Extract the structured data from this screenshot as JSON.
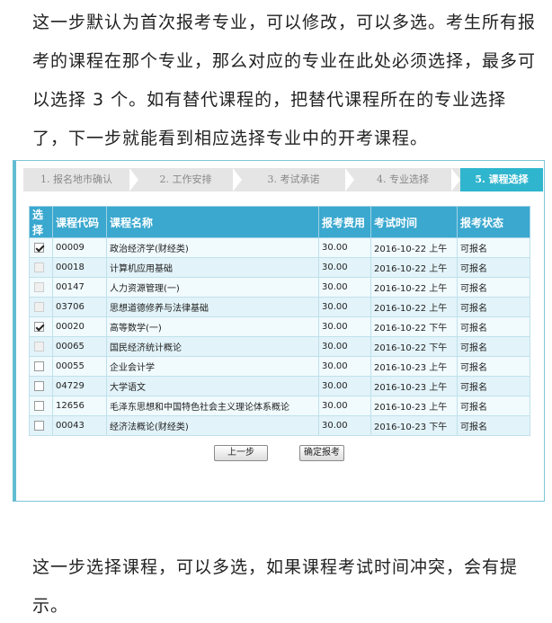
{
  "intro_text": "这一步默认为首次报考专业，可以修改，可以多选。考生所有报考的课程在那个专业，那么对应的专业在此处必须选择，最多可以选择 3 个。如有替代课程的，把替代课程所在的专业选择了，下一步就能看到相应选择专业中的开考课程。",
  "outro_text": "这一步选择课程，可以多选，如果课程考试时间冲突，会有提示。",
  "steps": [
    {
      "label": "1. 报名地市确认"
    },
    {
      "label": "2. 工作安排"
    },
    {
      "label": "3. 考试承诺"
    },
    {
      "label": "4. 专业选择"
    },
    {
      "label": "5. 课程选择"
    }
  ],
  "table": {
    "headers": [
      "选择",
      "课程代码",
      "课程名称",
      "报考费用",
      "考试时间",
      "报考状态"
    ],
    "rows": [
      {
        "checked": "true",
        "disabled": "false",
        "code": "00009",
        "name": "政治经济学(财经类)",
        "fee": "30.00",
        "time": "2016-10-22 上午",
        "status": "可报名"
      },
      {
        "checked": "false",
        "disabled": "true",
        "code": "00018",
        "name": "计算机应用基础",
        "fee": "30.00",
        "time": "2016-10-22 上午",
        "status": "可报名"
      },
      {
        "checked": "false",
        "disabled": "true",
        "code": "00147",
        "name": "人力资源管理(一)",
        "fee": "30.00",
        "time": "2016-10-22 上午",
        "status": "可报名"
      },
      {
        "checked": "false",
        "disabled": "true",
        "code": "03706",
        "name": "思想道德修养与法律基础",
        "fee": "30.00",
        "time": "2016-10-22 上午",
        "status": "可报名"
      },
      {
        "checked": "true",
        "disabled": "false",
        "code": "00020",
        "name": "高等数学(一)",
        "fee": "30.00",
        "time": "2016-10-22 下午",
        "status": "可报名"
      },
      {
        "checked": "false",
        "disabled": "true",
        "code": "00065",
        "name": "国民经济统计概论",
        "fee": "30.00",
        "time": "2016-10-22 下午",
        "status": "可报名"
      },
      {
        "checked": "false",
        "disabled": "false",
        "code": "00055",
        "name": "企业会计学",
        "fee": "30.00",
        "time": "2016-10-23 上午",
        "status": "可报名"
      },
      {
        "checked": "false",
        "disabled": "false",
        "code": "04729",
        "name": "大学语文",
        "fee": "30.00",
        "time": "2016-10-23 上午",
        "status": "可报名"
      },
      {
        "checked": "false",
        "disabled": "false",
        "code": "12656",
        "name": "毛泽东思想和中国特色社会主义理论体系概论",
        "fee": "30.00",
        "time": "2016-10-23 上午",
        "status": "可报名"
      },
      {
        "checked": "false",
        "disabled": "false",
        "code": "00043",
        "name": "经济法概论(财经类)",
        "fee": "30.00",
        "time": "2016-10-23 下午",
        "status": "可报名"
      }
    ]
  },
  "buttons": {
    "prev": "上一步",
    "confirm": "确定报考"
  },
  "colors": {
    "accent": "#2fb6ce",
    "header": "#3aa8cf",
    "panel_border": "#62bcd2"
  }
}
